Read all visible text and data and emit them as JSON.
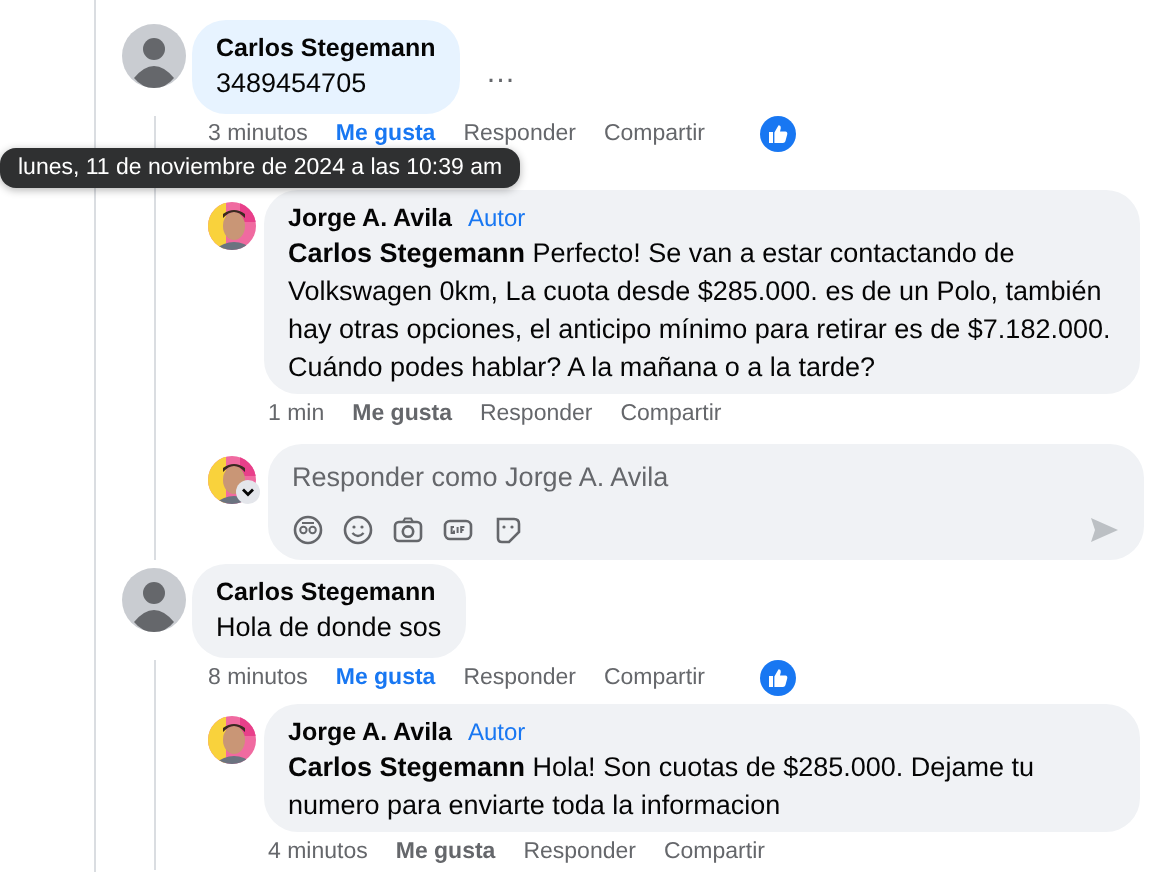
{
  "tooltip": "lunes, 11 de noviembre de 2024 a las 10:39 am",
  "comments": [
    {
      "author": "Carlos Stegemann",
      "text": "3489454705",
      "more": "…",
      "time": "3 minutos",
      "like": "Me gusta",
      "liked": true,
      "reply": "Responder",
      "share": "Compartir",
      "reaction": true,
      "replies": [
        {
          "author": "Jorge A. Avila",
          "badge": "Autor",
          "mention": "Carlos Stegemann",
          "text": "Perfecto! Se van a estar contactando de Volkswagen 0km, La cuota desde $285.000. es de un Polo, también hay otras opciones, el anticipo mínimo para retirar es de $7.182.000. Cuándo podes hablar? A la mañana o a la tarde?",
          "time": "1 min",
          "like": "Me gusta",
          "liked": false,
          "reply": "Responder",
          "share": "Compartir"
        }
      ],
      "composer": {
        "placeholder": "Responder como Jorge A. Avila"
      }
    },
    {
      "author": "Carlos Stegemann",
      "text": "Hola de donde sos",
      "time": "8 minutos",
      "like": "Me gusta",
      "liked": true,
      "reply": "Responder",
      "share": "Compartir",
      "reaction": true,
      "replies": [
        {
          "author": "Jorge A. Avila",
          "badge": "Autor",
          "mention": "Carlos Stegemann",
          "text": "Hola! Son cuotas de $285.000. Dejame tu numero para enviarte toda la informacion",
          "time": "4 minutos",
          "like": "Me gusta",
          "liked": false,
          "reply": "Responder",
          "share": "Compartir"
        }
      ]
    }
  ]
}
